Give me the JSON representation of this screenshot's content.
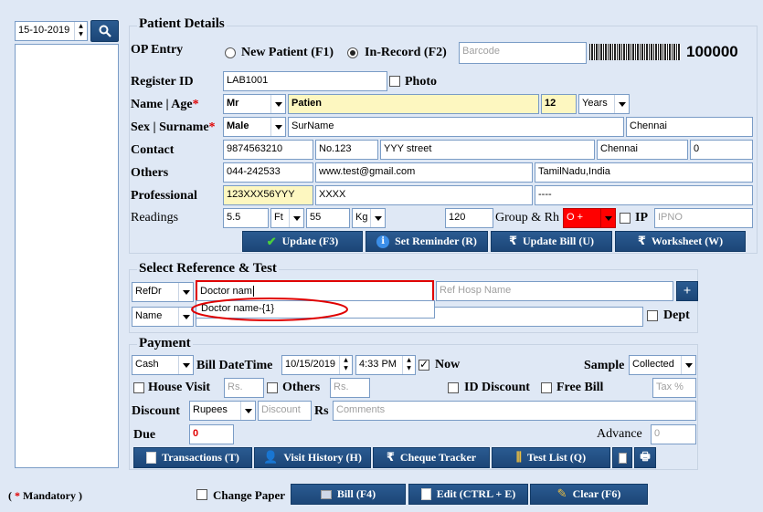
{
  "left": {
    "date": "15-10-2019",
    "search_icon": "search-icon"
  },
  "patient": {
    "title": "Patient Details",
    "op_entry": "OP Entry",
    "new_patient": "New Patient (F1)",
    "in_record": "In-Record (F2)",
    "barcode_ph": "Barcode",
    "op_number": "100000",
    "register_id_lbl": "Register ID",
    "register_id": "LAB1001",
    "photo": "Photo",
    "name_age_lbl": "Name | Age",
    "title_sel": "Mr",
    "name": "Patien",
    "age": "12",
    "age_unit": "Years",
    "sex_surname_lbl": "Sex | Surname",
    "sex": "Male",
    "surname": "SurName",
    "city1": "Chennai",
    "contact_lbl": "Contact",
    "phone": "9874563210",
    "door": "No.123",
    "street": "YYY street",
    "city2": "Chennai",
    "pin": "0",
    "others_lbl": "Others",
    "landline": "044-242533",
    "email": "www.test@gmail.com",
    "state": "TamilNadu,India",
    "professional_lbl": "Professional",
    "prof_id": "123XXX56YYY",
    "prof_name": "XXXX",
    "prof_extra": "----",
    "readings_lbl": "Readings",
    "height": "5.5",
    "height_unit": "Ft",
    "weight": "55",
    "weight_unit": "Kg",
    "bp": "120",
    "group_lbl": "Group & Rh",
    "blood_group": "O +",
    "ip_lbl": "IP",
    "ipno_ph": "IPNO",
    "update": "Update (F3)",
    "set_reminder": "Set Reminder (R)",
    "update_bill": "Update Bill (U)",
    "worksheet": "Worksheet (W)"
  },
  "reference": {
    "title": "Select Reference & Test",
    "ref_type": "RefDr",
    "doctor": "Doctor nam",
    "ref_hosp_ph": "Ref Hosp Name",
    "add": "+",
    "test_type": "Name",
    "suggestion": "Doctor name-{1}",
    "dept": "Dept"
  },
  "payment": {
    "title": "Payment",
    "mode": "Cash",
    "bill_datetime_lbl": "Bill DateTime",
    "bill_date": "10/15/2019",
    "bill_time": "4:33 PM",
    "now": "Now",
    "sample_lbl": "Sample",
    "sample": "Collected",
    "house_visit": "House Visit",
    "rs_ph1": "Rs.",
    "others": "Others",
    "rs_ph2": "Rs.",
    "id_discount": "ID Discount",
    "free_bill": "Free Bill",
    "tax_ph": "Tax %",
    "discount_lbl": "Discount",
    "discount_type": "Rupees",
    "discount_ph": "Discount",
    "rs_lbl": "Rs",
    "comments_ph": "Comments",
    "due_lbl": "Due",
    "due": "0",
    "advance_lbl": "Advance",
    "advance": "0",
    "transactions": "Transactions (T)",
    "visit_history": "Visit History (H)",
    "cheque_tracker": "Cheque Tracker",
    "test_list": "Test List (Q)"
  },
  "footer": {
    "mandatory": "Mandatory )",
    "mandatory_open": "(",
    "change_paper": "Change Paper",
    "bill": "Bill (F4)",
    "edit": "Edit (CTRL + E)",
    "clear": "Clear (F6)"
  },
  "colors": {
    "accent": "#1c4677",
    "highlight": "#fdf7c0",
    "alert": "#e00000"
  }
}
